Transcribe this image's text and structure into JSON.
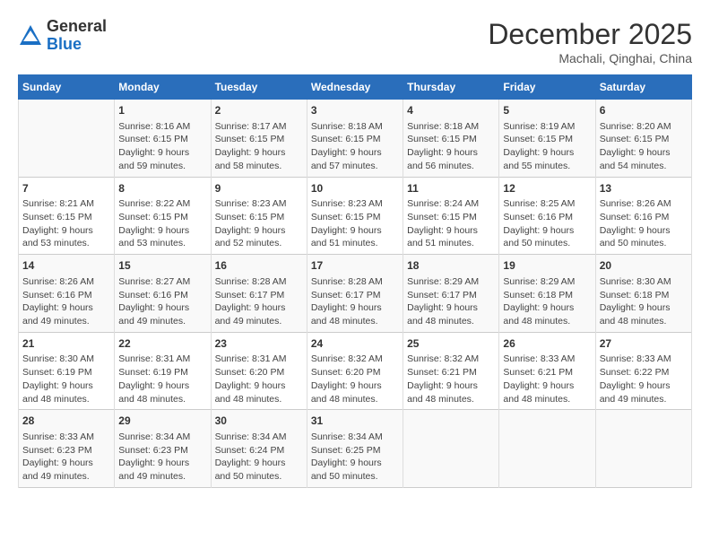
{
  "header": {
    "logo_general": "General",
    "logo_blue": "Blue",
    "month": "December 2025",
    "location": "Machali, Qinghai, China"
  },
  "days_of_week": [
    "Sunday",
    "Monday",
    "Tuesday",
    "Wednesday",
    "Thursday",
    "Friday",
    "Saturday"
  ],
  "weeks": [
    [
      {
        "day": "",
        "content": ""
      },
      {
        "day": "1",
        "content": "Sunrise: 8:16 AM\nSunset: 6:15 PM\nDaylight: 9 hours\nand 59 minutes."
      },
      {
        "day": "2",
        "content": "Sunrise: 8:17 AM\nSunset: 6:15 PM\nDaylight: 9 hours\nand 58 minutes."
      },
      {
        "day": "3",
        "content": "Sunrise: 8:18 AM\nSunset: 6:15 PM\nDaylight: 9 hours\nand 57 minutes."
      },
      {
        "day": "4",
        "content": "Sunrise: 8:18 AM\nSunset: 6:15 PM\nDaylight: 9 hours\nand 56 minutes."
      },
      {
        "day": "5",
        "content": "Sunrise: 8:19 AM\nSunset: 6:15 PM\nDaylight: 9 hours\nand 55 minutes."
      },
      {
        "day": "6",
        "content": "Sunrise: 8:20 AM\nSunset: 6:15 PM\nDaylight: 9 hours\nand 54 minutes."
      }
    ],
    [
      {
        "day": "7",
        "content": "Sunrise: 8:21 AM\nSunset: 6:15 PM\nDaylight: 9 hours\nand 53 minutes."
      },
      {
        "day": "8",
        "content": "Sunrise: 8:22 AM\nSunset: 6:15 PM\nDaylight: 9 hours\nand 53 minutes."
      },
      {
        "day": "9",
        "content": "Sunrise: 8:23 AM\nSunset: 6:15 PM\nDaylight: 9 hours\nand 52 minutes."
      },
      {
        "day": "10",
        "content": "Sunrise: 8:23 AM\nSunset: 6:15 PM\nDaylight: 9 hours\nand 51 minutes."
      },
      {
        "day": "11",
        "content": "Sunrise: 8:24 AM\nSunset: 6:15 PM\nDaylight: 9 hours\nand 51 minutes."
      },
      {
        "day": "12",
        "content": "Sunrise: 8:25 AM\nSunset: 6:16 PM\nDaylight: 9 hours\nand 50 minutes."
      },
      {
        "day": "13",
        "content": "Sunrise: 8:26 AM\nSunset: 6:16 PM\nDaylight: 9 hours\nand 50 minutes."
      }
    ],
    [
      {
        "day": "14",
        "content": "Sunrise: 8:26 AM\nSunset: 6:16 PM\nDaylight: 9 hours\nand 49 minutes."
      },
      {
        "day": "15",
        "content": "Sunrise: 8:27 AM\nSunset: 6:16 PM\nDaylight: 9 hours\nand 49 minutes."
      },
      {
        "day": "16",
        "content": "Sunrise: 8:28 AM\nSunset: 6:17 PM\nDaylight: 9 hours\nand 49 minutes."
      },
      {
        "day": "17",
        "content": "Sunrise: 8:28 AM\nSunset: 6:17 PM\nDaylight: 9 hours\nand 48 minutes."
      },
      {
        "day": "18",
        "content": "Sunrise: 8:29 AM\nSunset: 6:17 PM\nDaylight: 9 hours\nand 48 minutes."
      },
      {
        "day": "19",
        "content": "Sunrise: 8:29 AM\nSunset: 6:18 PM\nDaylight: 9 hours\nand 48 minutes."
      },
      {
        "day": "20",
        "content": "Sunrise: 8:30 AM\nSunset: 6:18 PM\nDaylight: 9 hours\nand 48 minutes."
      }
    ],
    [
      {
        "day": "21",
        "content": "Sunrise: 8:30 AM\nSunset: 6:19 PM\nDaylight: 9 hours\nand 48 minutes."
      },
      {
        "day": "22",
        "content": "Sunrise: 8:31 AM\nSunset: 6:19 PM\nDaylight: 9 hours\nand 48 minutes."
      },
      {
        "day": "23",
        "content": "Sunrise: 8:31 AM\nSunset: 6:20 PM\nDaylight: 9 hours\nand 48 minutes."
      },
      {
        "day": "24",
        "content": "Sunrise: 8:32 AM\nSunset: 6:20 PM\nDaylight: 9 hours\nand 48 minutes."
      },
      {
        "day": "25",
        "content": "Sunrise: 8:32 AM\nSunset: 6:21 PM\nDaylight: 9 hours\nand 48 minutes."
      },
      {
        "day": "26",
        "content": "Sunrise: 8:33 AM\nSunset: 6:21 PM\nDaylight: 9 hours\nand 48 minutes."
      },
      {
        "day": "27",
        "content": "Sunrise: 8:33 AM\nSunset: 6:22 PM\nDaylight: 9 hours\nand 49 minutes."
      }
    ],
    [
      {
        "day": "28",
        "content": "Sunrise: 8:33 AM\nSunset: 6:23 PM\nDaylight: 9 hours\nand 49 minutes."
      },
      {
        "day": "29",
        "content": "Sunrise: 8:34 AM\nSunset: 6:23 PM\nDaylight: 9 hours\nand 49 minutes."
      },
      {
        "day": "30",
        "content": "Sunrise: 8:34 AM\nSunset: 6:24 PM\nDaylight: 9 hours\nand 50 minutes."
      },
      {
        "day": "31",
        "content": "Sunrise: 8:34 AM\nSunset: 6:25 PM\nDaylight: 9 hours\nand 50 minutes."
      },
      {
        "day": "",
        "content": ""
      },
      {
        "day": "",
        "content": ""
      },
      {
        "day": "",
        "content": ""
      }
    ]
  ]
}
